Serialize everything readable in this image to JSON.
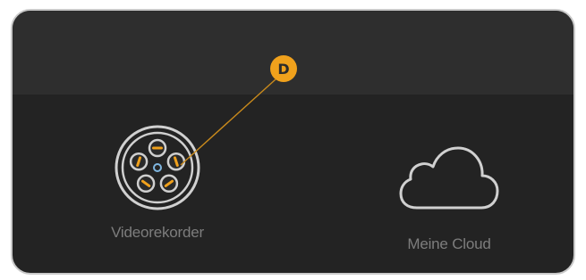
{
  "tiles": [
    {
      "label": "Videorekorder",
      "icon": "film-reel-icon"
    },
    {
      "label": "Meine Cloud",
      "icon": "cloud-icon"
    }
  ],
  "callout": {
    "letter": "D"
  },
  "colors": {
    "panel_background": "#232323",
    "header_band": "#2e2e2e",
    "icon_stroke": "#d0d0d0",
    "accent": "#f0a11c",
    "label_text": "#7d7d7d"
  }
}
